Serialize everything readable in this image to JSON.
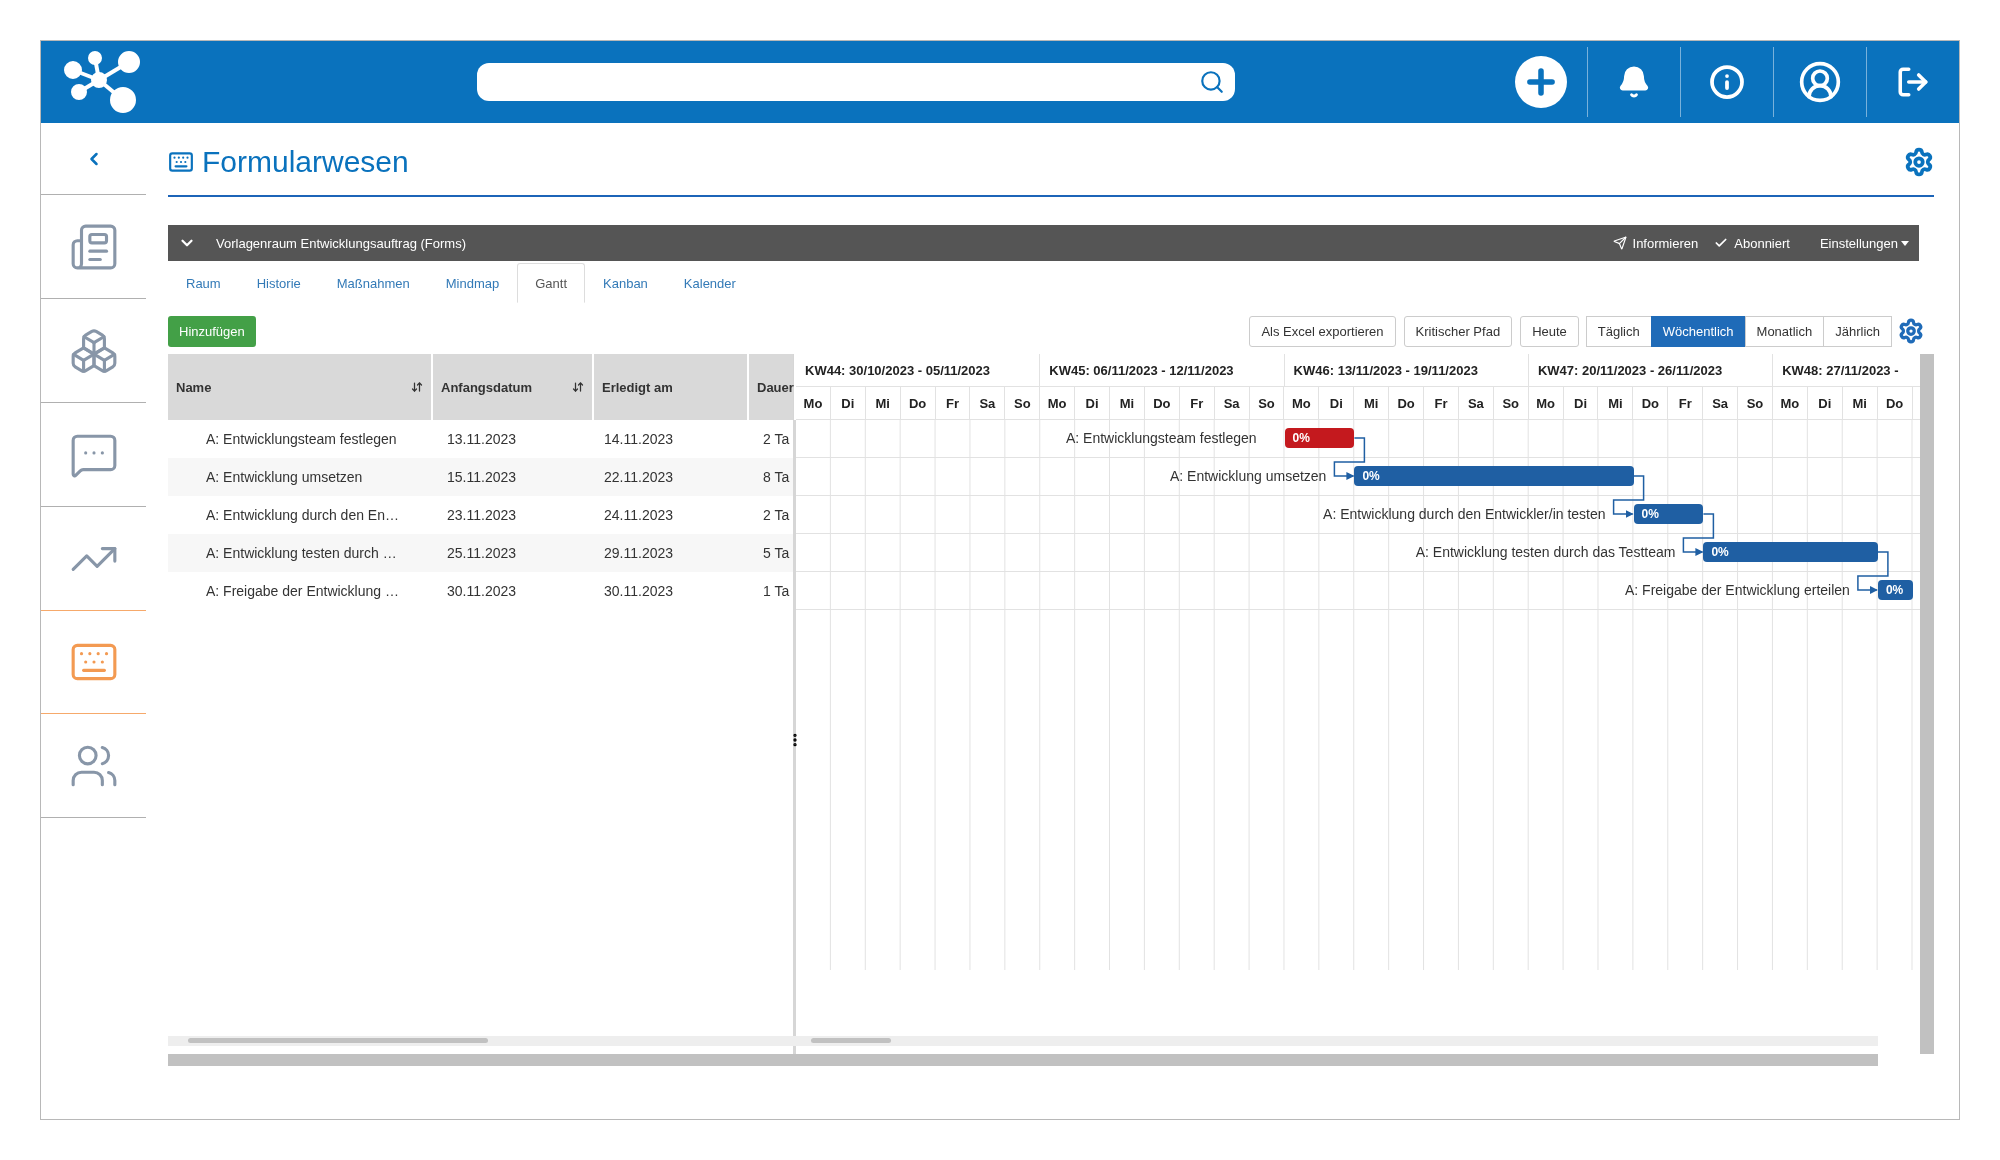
{
  "sidebar": {
    "items": [
      {
        "kind": "news",
        "selected": false
      },
      {
        "kind": "cubes",
        "selected": false
      },
      {
        "kind": "chat-frame",
        "selected": false
      },
      {
        "kind": "trend",
        "selected": false
      },
      {
        "kind": "form",
        "selected": true
      },
      {
        "kind": "people",
        "selected": false
      }
    ]
  },
  "page": {
    "title": "Formularwesen"
  },
  "room": {
    "title": "Vorlagenraum Entwicklungsauftrag (Forms)",
    "actions": [
      {
        "kind": "send",
        "label": "Informieren"
      },
      {
        "kind": "check",
        "label": "Abonniert"
      },
      {
        "kind": "dropdown",
        "label": "Einstellungen"
      }
    ]
  },
  "tabs": [
    {
      "label": "Raum",
      "selected": false
    },
    {
      "label": "Historie",
      "selected": false
    },
    {
      "label": "Maßnahmen",
      "selected": false
    },
    {
      "label": "Mindmap",
      "selected": false
    },
    {
      "label": "Gantt",
      "selected": true
    },
    {
      "label": "Kanban",
      "selected": false
    },
    {
      "label": "Kalender",
      "selected": false
    }
  ],
  "add_button": "Hinzufügen",
  "toolbar": {
    "buttons": [
      "Als Excel exportieren",
      "Kritischer Pfad",
      "Heute"
    ],
    "views": [
      {
        "label": "Täglich",
        "selected": false
      },
      {
        "label": "Wöchentlich",
        "selected": true
      },
      {
        "label": "Monatlich",
        "selected": false
      },
      {
        "label": "Jährlich",
        "selected": false
      }
    ]
  },
  "table": {
    "columns": [
      {
        "label": "Name",
        "sortable": true
      },
      {
        "label": "Anfangsdatum",
        "sortable": true
      },
      {
        "label": "Erledigt am",
        "sortable": false
      },
      {
        "label": "Dauer"
      }
    ],
    "rows": [
      {
        "name": "A: Entwicklungsteam festlegen",
        "start": "13.11.2023",
        "end": "14.11.2023",
        "duration": "2 Ta"
      },
      {
        "name": "A: Entwicklung umsetzen",
        "start": "15.11.2023",
        "end": "22.11.2023",
        "duration": "8 Ta"
      },
      {
        "name": "A: Entwicklung durch den En…",
        "start": "23.11.2023",
        "end": "24.11.2023",
        "duration": "2 Ta"
      },
      {
        "name": "A: Entwicklung testen durch …",
        "start": "25.11.2023",
        "end": "29.11.2023",
        "duration": "5 Ta"
      },
      {
        "name": "A: Freigabe der Entwicklung …",
        "start": "30.11.2023",
        "end": "30.11.2023",
        "duration": "1 Ta"
      }
    ]
  },
  "gantt": {
    "weeks": [
      "KW44: 30/10/2023 - 05/11/2023",
      "KW45: 06/11/2023 - 12/11/2023",
      "KW46: 13/11/2023 - 19/11/2023",
      "KW47: 20/11/2023 - 26/11/2023",
      "KW48: 27/11/2023 -"
    ],
    "days": [
      "Mo",
      "Di",
      "Mi",
      "Do",
      "Fr",
      "Sa",
      "So",
      "Mo",
      "Di",
      "Mi",
      "Do",
      "Fr",
      "Sa",
      "So",
      "Mo",
      "Di",
      "Mi",
      "Do",
      "Fr",
      "Sa",
      "So",
      "Mo",
      "Di",
      "Mi",
      "Do",
      "Fr",
      "Sa",
      "So",
      "Mo",
      "Di",
      "Mi",
      "Do"
    ],
    "tasks": [
      {
        "label": "A: Entwicklungsteam festlegen",
        "progress": "0%",
        "color": "#c4191e"
      },
      {
        "label": "A: Entwicklung umsetzen",
        "progress": "0%",
        "color": "#1f5fa3"
      },
      {
        "label": "A: Entwicklung durch den Entwickler/in testen",
        "progress": "0%",
        "color": "#1f5fa3"
      },
      {
        "label": "A: Entwicklung testen durch das Testteam",
        "progress": "0%",
        "color": "#1f5fa3"
      },
      {
        "label": "A: Freigabe der Entwicklung erteilen",
        "progress": "0%",
        "color": "#1f5fa3"
      }
    ]
  }
}
